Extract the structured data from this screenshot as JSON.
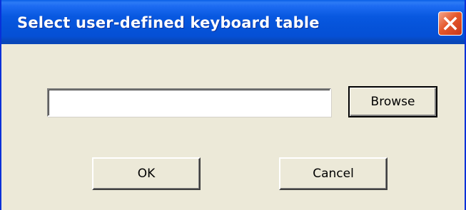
{
  "window": {
    "title": "Select user-defined keyboard table",
    "close_icon": "close-icon",
    "titlebar_color": "#0550d5",
    "close_color": "#e5582b"
  },
  "form": {
    "path_value": "",
    "browse_label": "Browse"
  },
  "actions": {
    "ok_label": "OK",
    "cancel_label": "Cancel"
  }
}
